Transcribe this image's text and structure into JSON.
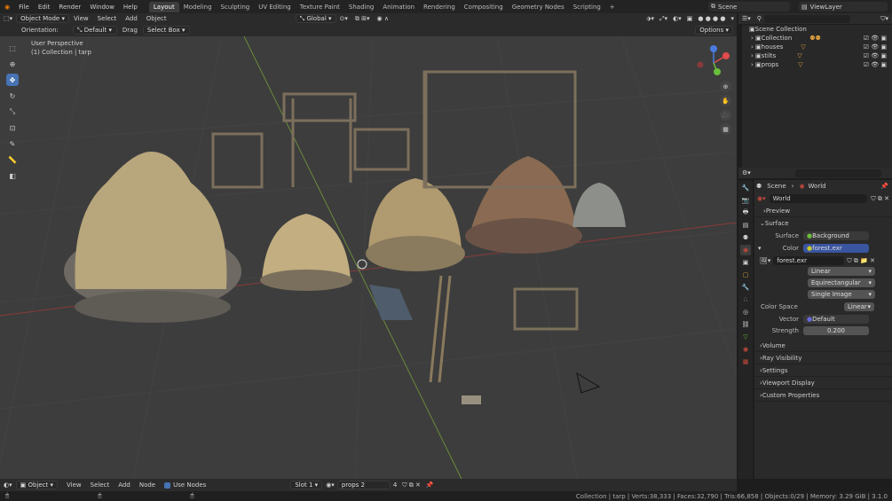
{
  "menu": [
    "File",
    "Edit",
    "Render",
    "Window",
    "Help"
  ],
  "workspace_tabs": [
    "Layout",
    "Modeling",
    "Sculpting",
    "UV Editing",
    "Texture Paint",
    "Shading",
    "Animation",
    "Rendering",
    "Compositing",
    "Geometry Nodes",
    "Scripting"
  ],
  "add_tab": "+",
  "scene_name": "Scene",
  "view_layer": "ViewLayer",
  "header": {
    "mode": "Object Mode",
    "menus": [
      "View",
      "Select",
      "Add",
      "Object"
    ],
    "transform_orientation": "Global"
  },
  "tool_settings": {
    "orientation_label": "Orientation:",
    "orientation_value": "Default",
    "drag_label": "Drag",
    "drag_value": "Select Box",
    "options": "Options"
  },
  "viewport": {
    "perspective": "User Perspective",
    "context": "(1) Collection | tarp"
  },
  "outliner": {
    "root": "Scene Collection",
    "items": [
      "Collection",
      "houses",
      "stilts",
      "props"
    ]
  },
  "properties": {
    "breadcrumb_scene": "Scene",
    "breadcrumb_world": "World",
    "world_name": "World",
    "sections": {
      "preview": "Preview",
      "surface": "Surface",
      "volume": "Volume",
      "ray_visibility": "Ray Visibility",
      "settings": "Settings",
      "viewport_display": "Viewport Display",
      "custom_properties": "Custom Properties"
    },
    "surface_label": "Surface",
    "surface_value": "Background",
    "color_label": "Color",
    "color_value": "forest.exr",
    "image_name": "forest.exr",
    "interp": "Linear",
    "projection": "Equirectangular",
    "source": "Single Image",
    "color_space_label": "Color Space",
    "color_space": "Linear",
    "vector_label": "Vector",
    "vector_value": "Default",
    "strength_label": "Strength",
    "strength_value": "0.200"
  },
  "bottom": {
    "editor_mode": "Object",
    "menus": [
      "View",
      "Select",
      "Add",
      "Node"
    ],
    "use_nodes": "Use Nodes",
    "slot": "Slot 1",
    "material": "props 2",
    "users": "4"
  },
  "status_text": "Collection | tarp | Verts:38,333 | Faces:32,790 | Tris:66,858 | Objects:0/29 | Memory: 3.29 GiB | 3.1.0",
  "colors": {
    "accent": "#4772b3",
    "socket_yellow": "#c7c729",
    "world_red": "#c94a3c"
  }
}
